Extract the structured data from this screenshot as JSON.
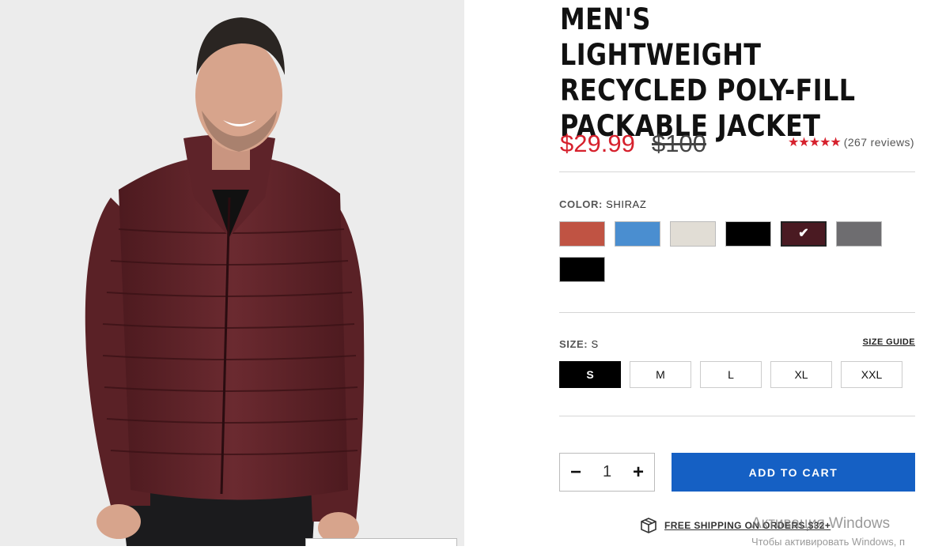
{
  "product": {
    "title": "MEN'S LIGHTWEIGHT RECYCLED POLY-FILL PACKABLE JACKET",
    "sale_price": "$29.99",
    "original_price": "$100",
    "rating_stars": "★★★★★",
    "review_count": "(267 reviews)"
  },
  "color": {
    "label": "COLOR:",
    "selected_name": "SHIRAZ",
    "swatches": [
      {
        "color": "#c05343"
      },
      {
        "color": "#4a8ed0"
      },
      {
        "color": "#e1ddd5"
      },
      {
        "color": "#000000"
      },
      {
        "color": "#4a1a22",
        "selected": true,
        "check": "✔"
      },
      {
        "color": "#6e6d70"
      },
      {
        "color": "#000000"
      }
    ]
  },
  "size": {
    "label": "SIZE:",
    "selected": "S",
    "guide_label": "SIZE GUIDE",
    "options": [
      "S",
      "M",
      "L",
      "XL",
      "XXL"
    ]
  },
  "cart": {
    "minus": "−",
    "plus": "+",
    "quantity": "1",
    "add_label": "ADD TO CART"
  },
  "shipping": {
    "icon": "box-icon",
    "text": "FREE SHIPPING ON ORDERS $32+"
  },
  "watermark": {
    "line1": "Активация Windows",
    "line2": "Чтобы активировать Windows, п"
  }
}
